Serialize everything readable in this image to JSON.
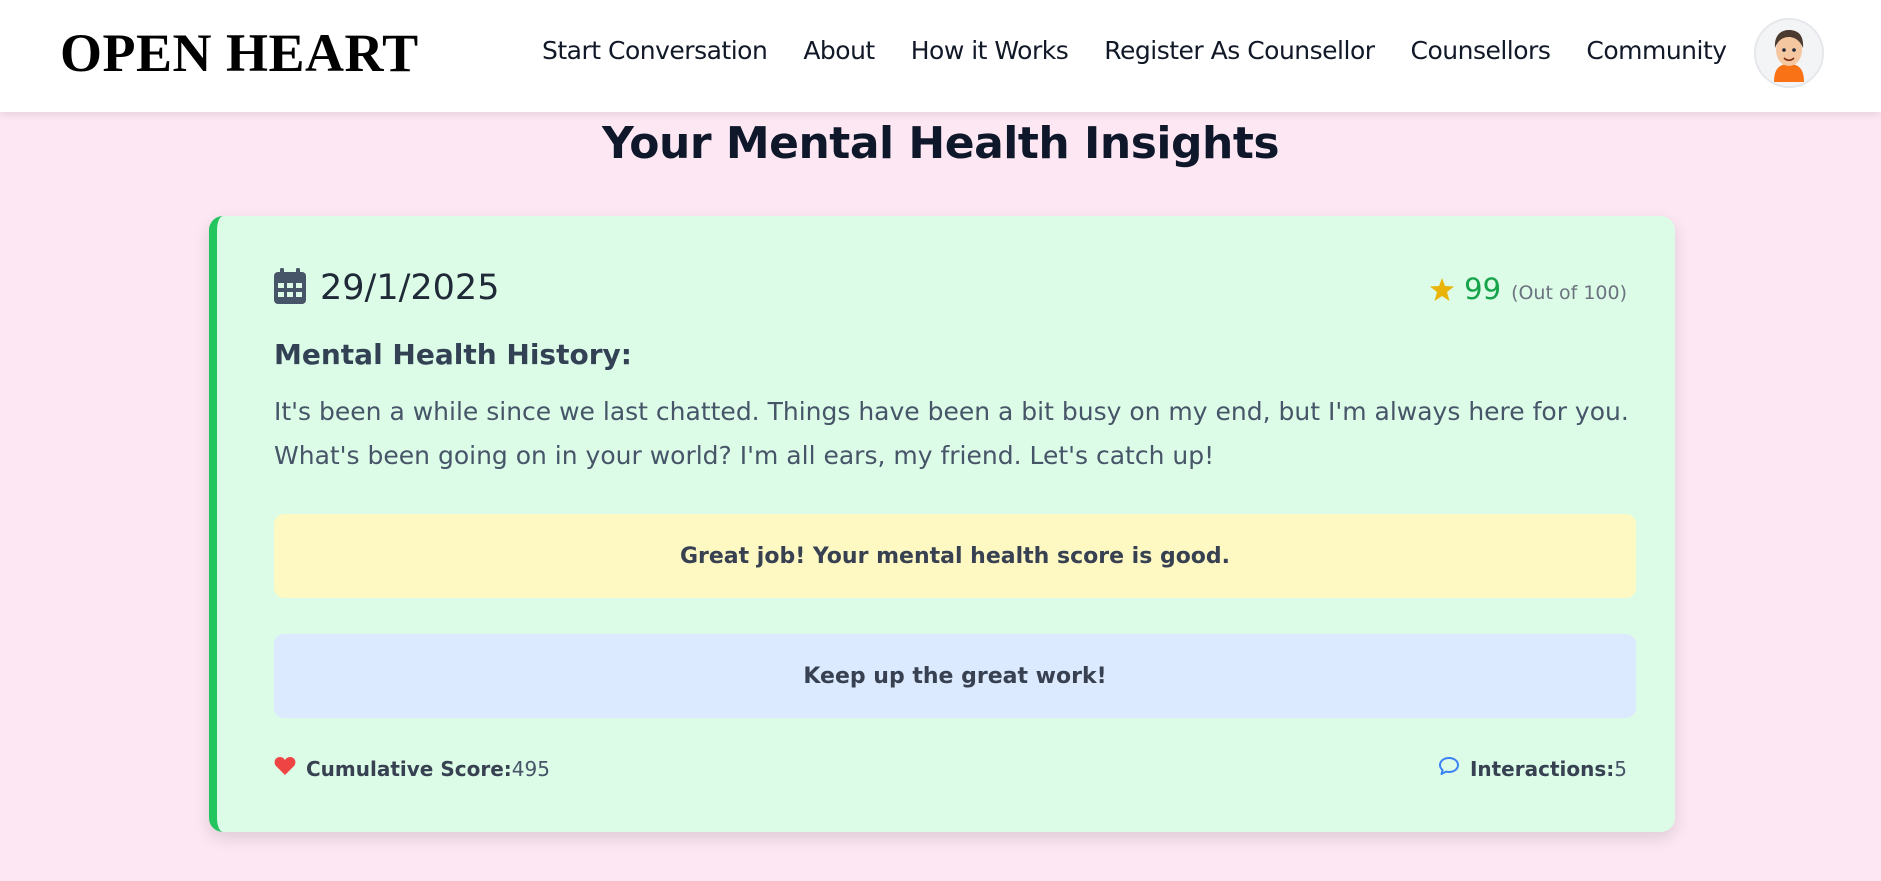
{
  "brand": {
    "name": "OPEN HEART"
  },
  "nav": {
    "items": [
      {
        "label": "Start Conversation"
      },
      {
        "label": "About"
      },
      {
        "label": "How it Works"
      },
      {
        "label": "Register As Counsellor"
      },
      {
        "label": "Counsellors"
      },
      {
        "label": "Community"
      }
    ],
    "avatar_icon": "user-avatar"
  },
  "page": {
    "title": "Your Mental Health Insights"
  },
  "insight": {
    "date": "29/1/2025",
    "date_icon": "calendar-icon",
    "score": "99",
    "score_scale": "(Out of 100)",
    "score_icon": "star-icon",
    "history_heading": "Mental Health History:",
    "history_text": "It's been a while since we last chatted. Things have been a bit busy on my end, but I'm always here for you. What's been going on in your world? I'm all ears, my friend. Let's catch up!",
    "score_message": "Great job! Your mental health score is good.",
    "encouragement": "Keep up the great work!",
    "cumulative_label": "Cumulative Score:",
    "cumulative_value": "495",
    "cumulative_icon": "heart-icon",
    "interactions_label": "Interactions:",
    "interactions_value": "5",
    "interactions_icon": "chat-bubble-icon"
  },
  "colors": {
    "page_bg": "#fce7f3",
    "card_bg": "#dcfce7",
    "card_accent": "#22c55e",
    "score_green": "#16a34a",
    "star_yellow": "#eab308",
    "heart_red": "#ef4444",
    "chat_blue": "#3b82f6",
    "banner_yellow": "#fef9c3",
    "banner_blue": "#dbeafe"
  }
}
